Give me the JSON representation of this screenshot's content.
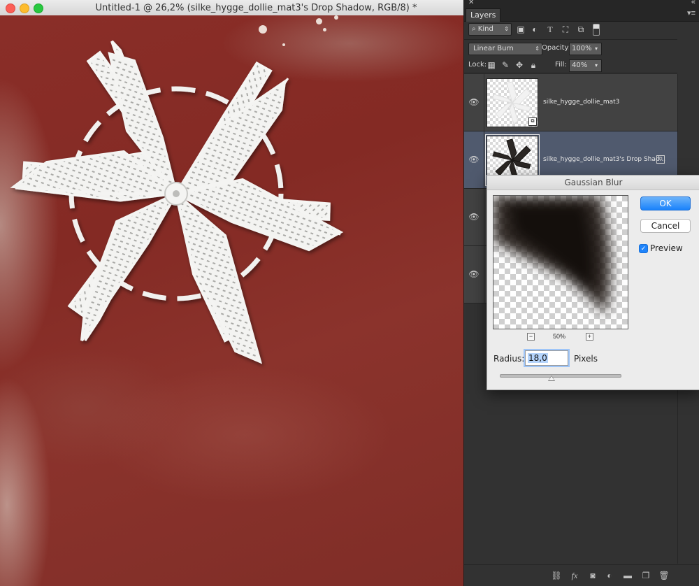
{
  "window": {
    "title": "Untitled-1 @ 26,2% (silke_hygge_dollie_mat3's Drop Shadow, RGB/8) *"
  },
  "panel": {
    "tab_label": "Layers",
    "filter_kind": "Kind",
    "blend_mode": "Linear Burn",
    "opacity_label": "Opacity:",
    "opacity_value": "100%",
    "lock_label": "Lock:",
    "fill_label": "Fill:",
    "fill_value": "40%",
    "layers": [
      {
        "name": "silke_hygge_dollie_mat3",
        "selected": false,
        "visible": true
      },
      {
        "name": "silke_hygge_dollie_mat3's Drop Shad...",
        "selected": true,
        "visible": true
      }
    ]
  },
  "dialog": {
    "title": "Gaussian Blur",
    "ok_label": "OK",
    "cancel_label": "Cancel",
    "preview_label": "Preview",
    "preview_checked": true,
    "zoom_level": "50%",
    "radius_label": "Radius:",
    "radius_value": "18,0",
    "radius_unit": "Pixels",
    "accent_color": "#1a82fb"
  },
  "colors": {
    "canvas_bg": "#8a2e28",
    "panel_bg": "#323232",
    "selected_layer": "#505a6e"
  }
}
